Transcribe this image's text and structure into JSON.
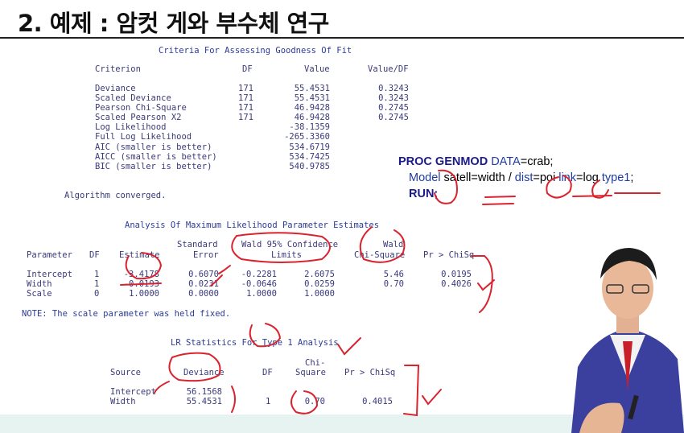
{
  "slide_title": "2. 예제 : 암컷 게와 부수체 연구",
  "fit": {
    "heading": "Criteria For Assessing Goodness Of Fit",
    "columns": [
      "Criterion",
      "DF",
      "Value",
      "Value/DF"
    ],
    "rows": [
      [
        "Deviance",
        "171",
        "55.4531",
        "0.3243"
      ],
      [
        "Scaled Deviance",
        "171",
        "55.4531",
        "0.3243"
      ],
      [
        "Pearson Chi-Square",
        "171",
        "46.9428",
        "0.2745"
      ],
      [
        "Scaled Pearson X2",
        "171",
        "46.9428",
        "0.2745"
      ],
      [
        "Log Likelihood",
        "",
        "-38.1359",
        ""
      ],
      [
        "Full Log Likelihood",
        "",
        "-265.3360",
        ""
      ],
      [
        "AIC (smaller is better)",
        "",
        "534.6719",
        ""
      ],
      [
        "AICC (smaller is better)",
        "",
        "534.7425",
        ""
      ],
      [
        "BIC (smaller is better)",
        "",
        "540.9785",
        ""
      ]
    ]
  },
  "converged": "Algorithm converged.",
  "code": {
    "line1_kw": "PROC GENMOD",
    "line1_opt": "DATA",
    "line1_rest": "=crab;",
    "line2_model": "Model",
    "line2_mid": " satell=width / ",
    "line2_dist": "dist",
    "line2_poi": "=poi ",
    "line2_link": "link",
    "line2_log": "=log ",
    "line2_type": "type1",
    "line2_end": ";",
    "line3": "RUN;"
  },
  "mle": {
    "heading": "Analysis Of Maximum Likelihood Parameter Estimates",
    "head1": [
      "Standard",
      "Wald 95% Confidence",
      "Wald"
    ],
    "head2": [
      "Parameter",
      "DF",
      "Estimate",
      "Error",
      "Limits",
      "Chi-Square",
      "Pr > ChiSq"
    ],
    "rows": [
      [
        "Intercept",
        "1",
        "-3.4178",
        "0.6070",
        "-0.2281",
        "2.6075",
        "5.46",
        "0.0195"
      ],
      [
        "Width",
        "1",
        "-0.0193",
        "0.0231",
        "-0.0646",
        "0.0259",
        "0.70",
        "0.4026"
      ],
      [
        "Scale",
        "0",
        "1.0000",
        "0.0000",
        "1.0000",
        "1.0000",
        "",
        ""
      ]
    ],
    "note": "NOTE: The scale parameter was held fixed."
  },
  "lr": {
    "heading": "LR Statistics For Type 1 Analysis",
    "chi_top": "Chi-",
    "columns": [
      "Source",
      "Deviance",
      "DF",
      "Square",
      "Pr > ChiSq"
    ],
    "rows": [
      [
        "Intercept",
        "56.1568",
        "",
        "",
        ""
      ],
      [
        "Width",
        "55.4531",
        "1",
        "0.70",
        "0.4015"
      ]
    ]
  },
  "colors": {
    "ink_red": "#d9232e",
    "output_blue": "#2b3a9a",
    "bottom_bar": "#e6f3f1"
  }
}
